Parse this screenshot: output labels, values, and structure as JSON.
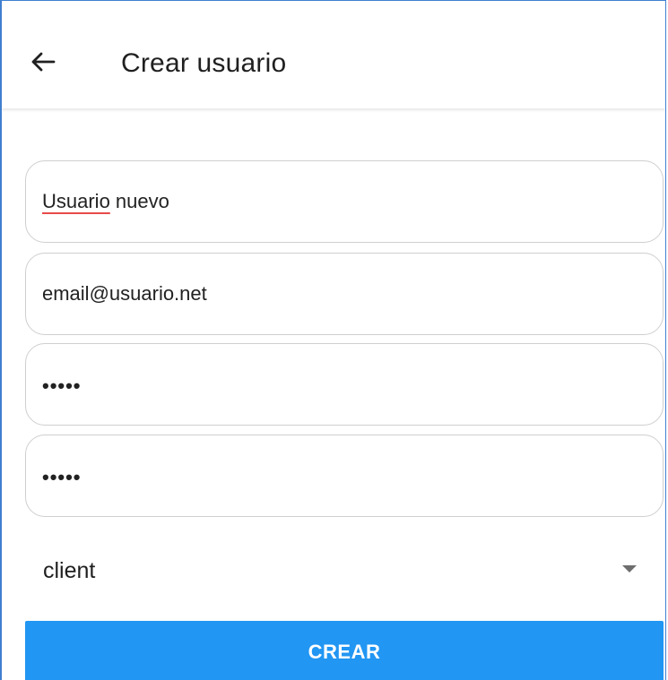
{
  "header": {
    "title": "Crear usuario",
    "back_icon": "arrow-left-icon"
  },
  "form": {
    "name_value": "Usuario nuevo",
    "name_value_first_word": "Usuario",
    "name_value_rest": " nuevo",
    "email_value": "email@usuario.net",
    "password_mask": "•••••",
    "confirm_password_mask": "•••••",
    "role_selected": "client",
    "dropdown_icon": "caret-down-icon"
  },
  "actions": {
    "submit_label": "CREAR"
  },
  "colors": {
    "primary": "#2196f3",
    "spellcheck_underline": "#e84a4a",
    "frame_border": "#3f7fd0"
  }
}
